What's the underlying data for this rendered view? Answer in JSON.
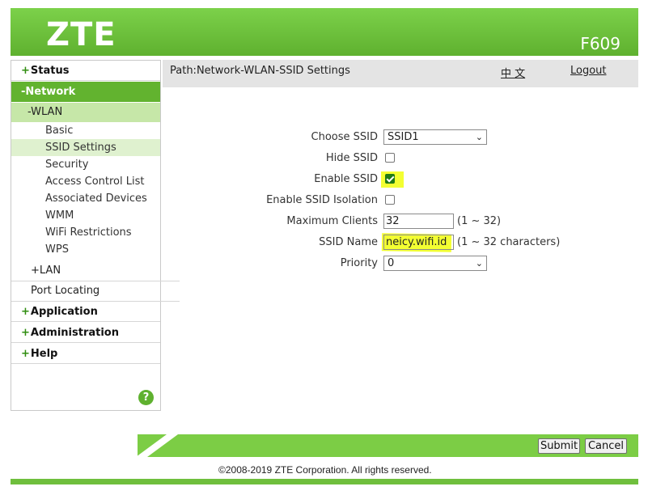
{
  "header": {
    "logo": "ZTE",
    "model": "F609"
  },
  "nav": {
    "status": "Status",
    "network": "-Network",
    "wlan": "-WLAN",
    "wlan_items": [
      "Basic",
      "SSID Settings",
      "Security",
      "Access Control List",
      "Associated Devices",
      "WMM",
      "WiFi Restrictions",
      "WPS"
    ],
    "lan": "+LAN",
    "port_locating": "Port Locating",
    "application": "Application",
    "administration": "Administration",
    "help": "Help",
    "help_icon": "?"
  },
  "pathbar": {
    "path": "Path:Network-WLAN-SSID Settings",
    "language": "中 文",
    "logout": "Logout"
  },
  "form": {
    "choose_ssid_label": "Choose SSID",
    "choose_ssid_value": "SSID1",
    "hide_ssid_label": "Hide SSID",
    "hide_ssid_checked": false,
    "enable_ssid_label": "Enable SSID",
    "enable_ssid_checked": true,
    "isolation_label": "Enable SSID Isolation",
    "isolation_checked": false,
    "max_clients_label": "Maximum Clients",
    "max_clients_value": "32",
    "max_clients_hint": "(1 ~ 32)",
    "ssid_name_label": "SSID Name",
    "ssid_name_value": "neicy.wifi.id",
    "ssid_name_hint": "(1 ~ 32 characters)",
    "priority_label": "Priority",
    "priority_value": "0"
  },
  "buttons": {
    "submit": "Submit",
    "cancel": "Cancel"
  },
  "footer": {
    "copyright": "©2008-2019 ZTE Corporation. All rights reserved."
  },
  "colors": {
    "brand_green": "#6dbf3b",
    "highlight": "#f2ff1c"
  }
}
